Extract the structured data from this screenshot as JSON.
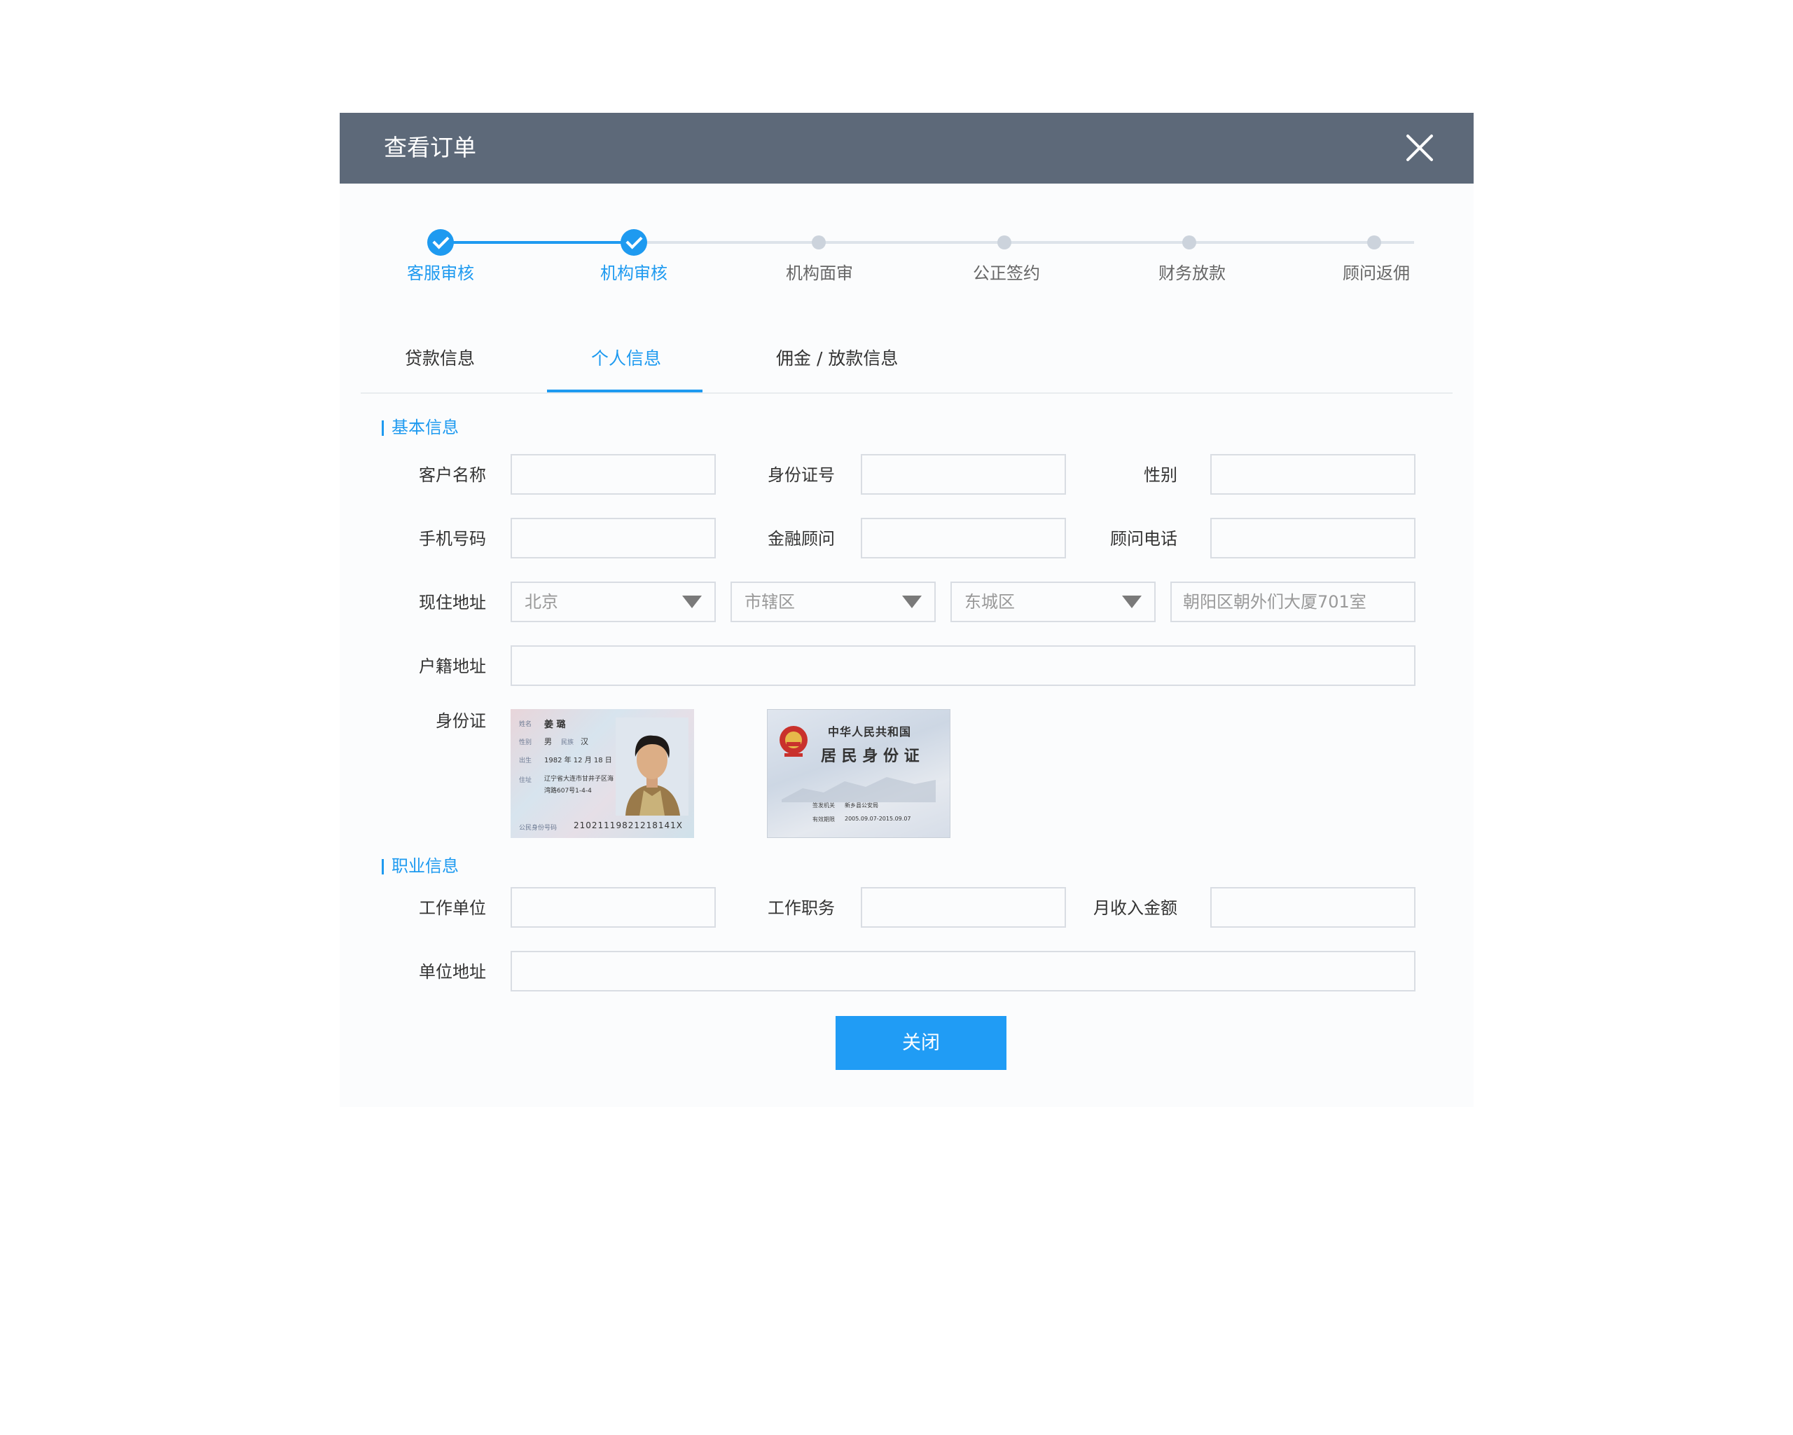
{
  "dialog": {
    "title": "查看订单"
  },
  "steps": [
    {
      "label": "客服审核",
      "done": true
    },
    {
      "label": "机构审核",
      "done": true
    },
    {
      "label": "机构面审",
      "done": false
    },
    {
      "label": "公正签约",
      "done": false
    },
    {
      "label": "财务放款",
      "done": false
    },
    {
      "label": "顾问返佣",
      "done": false
    }
  ],
  "tabs": [
    {
      "label": "贷款信息",
      "active": false
    },
    {
      "label": "个人信息",
      "active": true
    },
    {
      "label": "佣金 / 放款信息",
      "active": false
    }
  ],
  "basic": {
    "title": "基本信息",
    "customer_name": {
      "label": "客户名称",
      "value": ""
    },
    "id_number": {
      "label": "身份证号",
      "value": ""
    },
    "gender": {
      "label": "性别",
      "value": ""
    },
    "phone": {
      "label": "手机号码",
      "value": ""
    },
    "advisor": {
      "label": "金融顾问",
      "value": ""
    },
    "advisor_phone": {
      "label": "顾问电话",
      "value": ""
    },
    "address": {
      "label": "现住地址",
      "province": "北京",
      "city": "市辖区",
      "district": "东城区",
      "detail": "朝阳区朝外们大厦701室"
    },
    "household": {
      "label": "户籍地址",
      "value": ""
    },
    "id_card": {
      "label": "身份证",
      "front": {
        "name_label": "姓名",
        "name": "姜 璐",
        "sex_label": "性别",
        "sex": "男",
        "ethnic_label": "民族",
        "ethnic": "汉",
        "birth_label": "出生",
        "birth": "1982 年 12 月 18 日",
        "addr_label": "住址",
        "addr1": "辽宁省大连市甘井子区海",
        "addr2": "湾路607号1-4-4",
        "number_label": "公民身份号码",
        "number": "21021119821218141X"
      },
      "back": {
        "country": "中华人民共和国",
        "title": "居 民 身 份 证",
        "authority_label": "签发机关",
        "authority": "新乡县公安局",
        "valid_label": "有效期限",
        "valid": "2005.09.07-2015.09.07"
      }
    }
  },
  "career": {
    "title": "职业信息",
    "employer": {
      "label": "工作单位",
      "value": ""
    },
    "position": {
      "label": "工作职务",
      "value": ""
    },
    "income": {
      "label": "月收入金额",
      "value": ""
    },
    "employer_address": {
      "label": "单位地址",
      "value": ""
    }
  },
  "footer": {
    "close_label": "关闭"
  },
  "colors": {
    "accent": "#1e9af0",
    "header": "#5d6979"
  }
}
